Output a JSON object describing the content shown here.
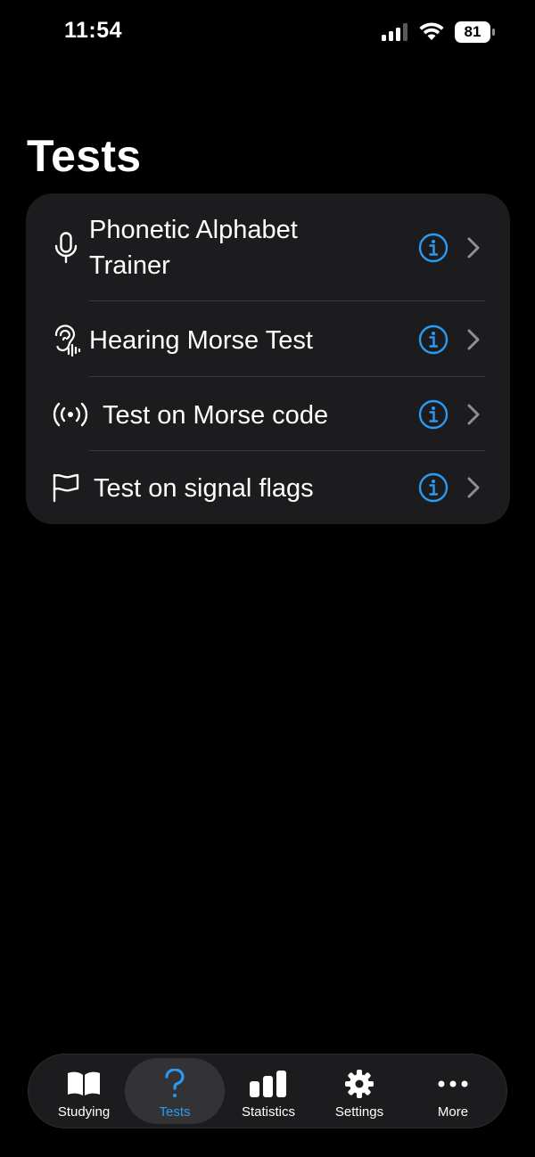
{
  "status_bar": {
    "time": "11:54",
    "battery_level": "81"
  },
  "page": {
    "title": "Tests"
  },
  "tests_list": {
    "items": [
      {
        "label": "Phonetic Alphabet Trainer",
        "icon": "microphone-icon"
      },
      {
        "label": "Hearing Morse Test",
        "icon": "ear-hearing-icon"
      },
      {
        "label": "Test on Morse code",
        "icon": "broadcast-waves-icon"
      },
      {
        "label": "Test on signal flags",
        "icon": "flag-icon"
      }
    ]
  },
  "tab_bar": {
    "tabs": [
      {
        "label": "Studying",
        "icon": "book-icon",
        "selected": false
      },
      {
        "label": "Tests",
        "icon": "question-mark-icon",
        "selected": true
      },
      {
        "label": "Statistics",
        "icon": "bar-chart-icon",
        "selected": false
      },
      {
        "label": "Settings",
        "icon": "gear-icon",
        "selected": false
      },
      {
        "label": "More",
        "icon": "ellipsis-icon",
        "selected": false
      }
    ]
  },
  "colors": {
    "background": "#000000",
    "card": "#1c1c1e",
    "accent": "#2b9af3",
    "separator": "#3a3a3c",
    "chevron": "#8e8e93"
  }
}
